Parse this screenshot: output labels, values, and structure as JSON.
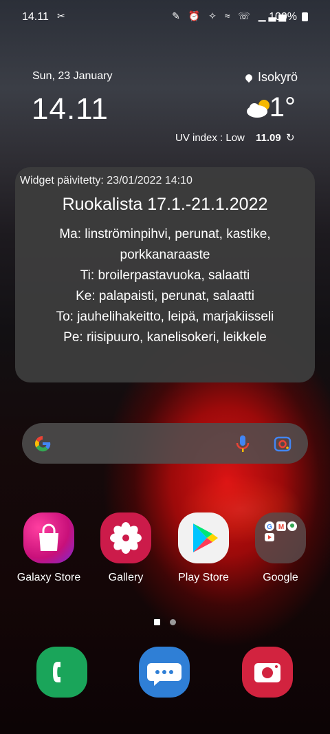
{
  "status_bar": {
    "time": "14.11",
    "sym": "✂",
    "icons": "✎ ⏰ ✧ ≈ ☏ ▁▃▅",
    "battery": "100%"
  },
  "clock_widget": {
    "date": "Sun, 23 January",
    "time": "14.11",
    "location": "Isokyrö",
    "temperature": "1°",
    "uv_index": "UV index : Low",
    "updated_time": "11.09"
  },
  "menu_widget": {
    "updated": "Widget päivitetty: 23/01/2022 14:10",
    "title": "Ruokalista 17.1.-21.1.2022",
    "lines": [
      "Ma: linströminpihvi, perunat, kastike,",
      "porkkanaraaste",
      "Ti: broilerpastavuoka, salaatti",
      "Ke: palapaisti, perunat, salaatti",
      "To: jauhelihakeitto, leipä, marjakiisseli",
      "Pe: riisipuuro, kanelisokeri, leikkele"
    ]
  },
  "apps": [
    {
      "label": "Galaxy Store",
      "icon": "shopping-bag-icon"
    },
    {
      "label": "Gallery",
      "icon": "flower-icon"
    },
    {
      "label": "Play Store",
      "icon": "play-triangle-icon"
    },
    {
      "label": "Google",
      "icon": "folder-icon"
    }
  ],
  "dock": [
    {
      "icon": "phone-icon",
      "color": "#1aa55a"
    },
    {
      "icon": "messages-icon",
      "color": "#2f7fd6"
    },
    {
      "icon": "camera-icon",
      "color": "#d2233f"
    }
  ],
  "colors": {
    "widget_bg": "#3c3c3c",
    "search_bg": "#505050",
    "galaxy_store": "#e0207a",
    "gallery": "#cc1b4a",
    "play_store": "#f2f2f2",
    "google_folder": "#5a4a4a"
  }
}
